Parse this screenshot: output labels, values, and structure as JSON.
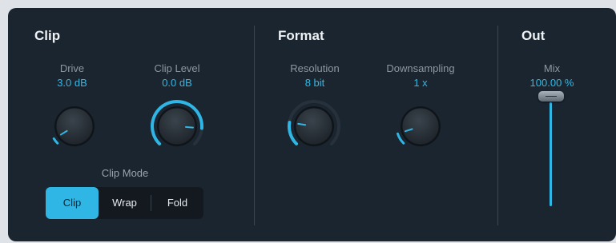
{
  "sections": {
    "clip": "Clip",
    "format": "Format",
    "out": "Out"
  },
  "knobs": [
    {
      "id": "drive",
      "label": "Drive",
      "value": "3.0 dB",
      "level": 0.05,
      "ring": false
    },
    {
      "id": "clip-level",
      "label": "Clip Level",
      "value": "0.0 dB",
      "level": 0.85,
      "ring": true
    },
    {
      "id": "resolution",
      "label": "Resolution",
      "value": "8 bit",
      "level": 0.2,
      "ring": true
    },
    {
      "id": "downsampling",
      "label": "Downsampling",
      "value": "1 x",
      "level": 0.1,
      "ring": false
    }
  ],
  "clip_mode": {
    "label": "Clip Mode",
    "options": [
      "Clip",
      "Wrap",
      "Fold"
    ],
    "selected": "Clip"
  },
  "mix": {
    "label": "Mix",
    "value": "100.00 %",
    "level": 1.0
  },
  "colors": {
    "accent": "#2fb6e4",
    "panel": "#1b2530",
    "label": "#8d979f"
  }
}
